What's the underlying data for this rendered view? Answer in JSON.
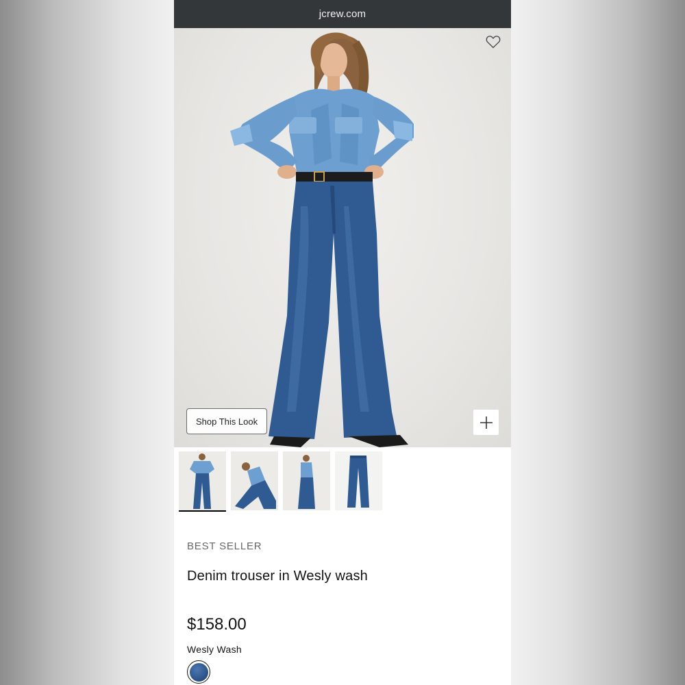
{
  "browser": {
    "url": "jcrew.com"
  },
  "product_image": {
    "favorite_icon": "heart-outline-icon",
    "shop_look_label": "Shop This Look",
    "add_icon": "plus-icon"
  },
  "thumbnails": [
    {
      "name": "model-front-view",
      "selected": true
    },
    {
      "name": "model-kneeling-view",
      "selected": false
    },
    {
      "name": "model-side-view",
      "selected": false
    },
    {
      "name": "flat-lay-jeans",
      "selected": false
    }
  ],
  "product": {
    "badge": "BEST SELLER",
    "title": "Denim trouser in Wesly wash",
    "price": "$158.00",
    "color_label": "Wesly Wash"
  },
  "colors": {
    "denim": "#2d568e",
    "url_bar": "#33373a"
  }
}
